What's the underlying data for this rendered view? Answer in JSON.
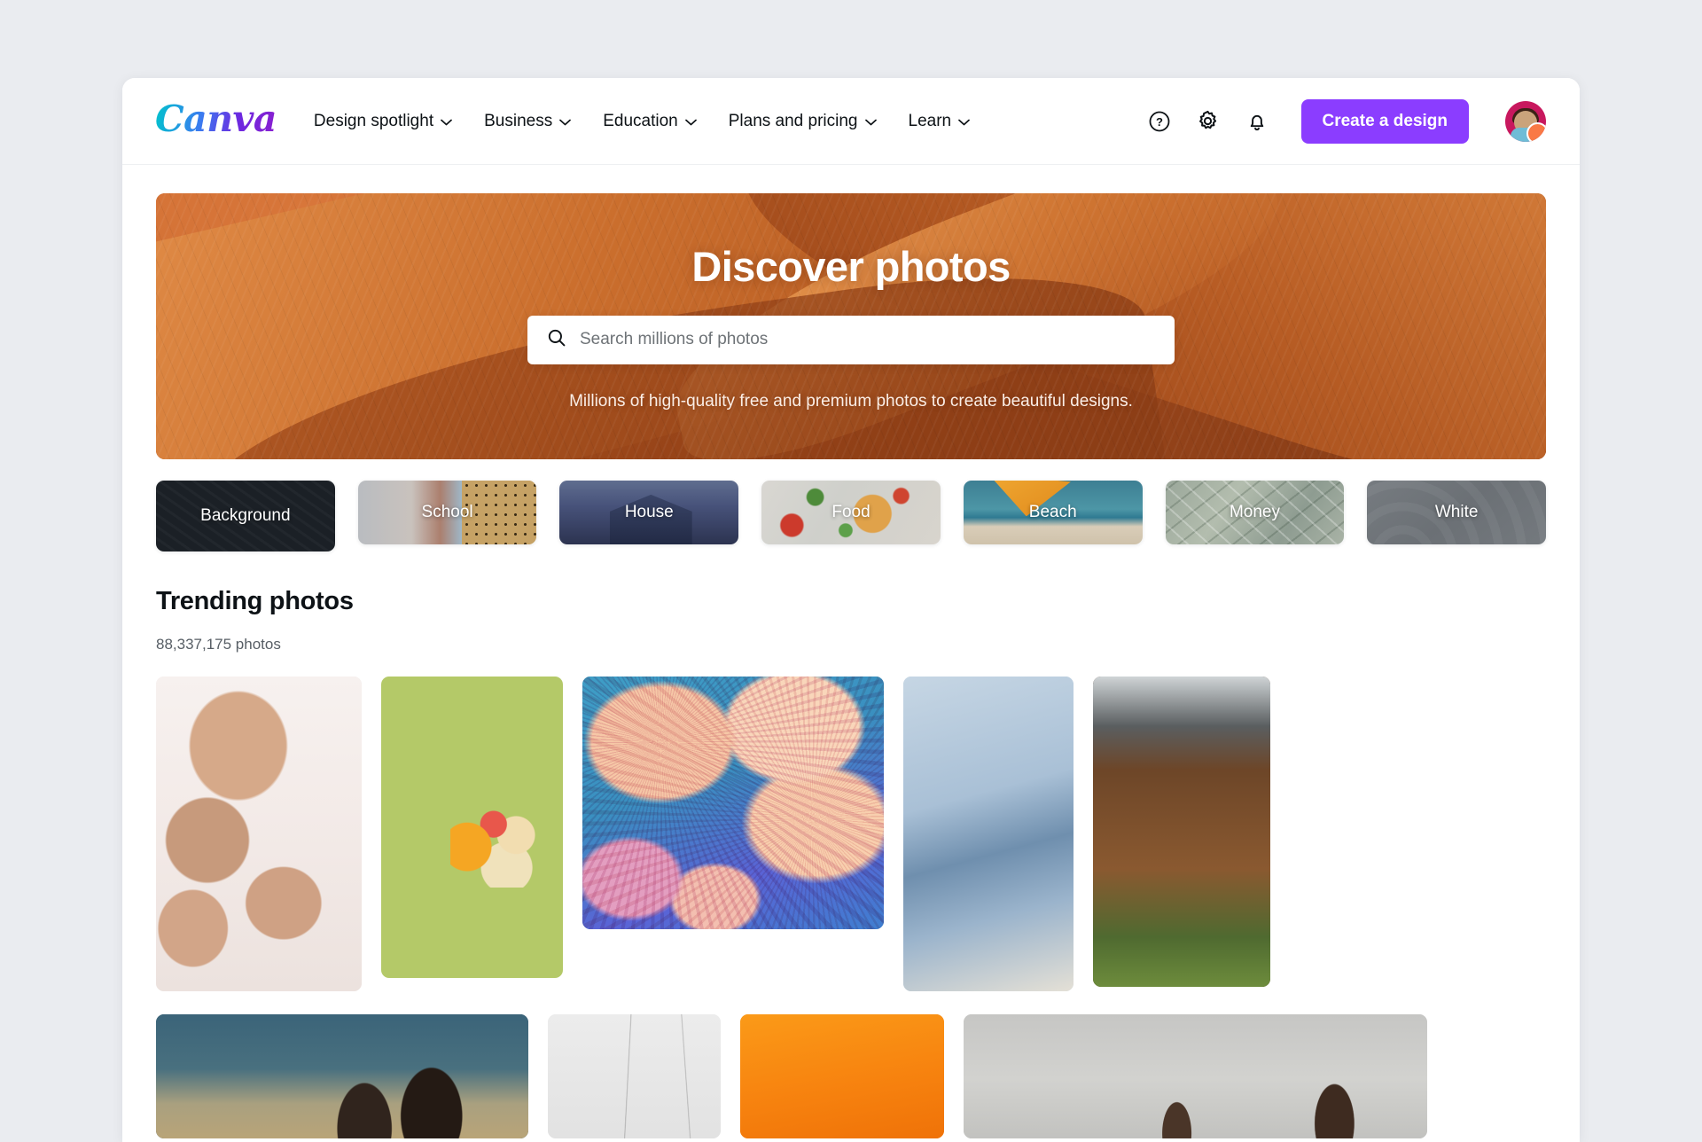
{
  "brand": {
    "logo_text": "Canva",
    "accent_color": "#8b3dff"
  },
  "header": {
    "nav": [
      {
        "label": "Design spotlight",
        "has_chevron": true
      },
      {
        "label": "Business",
        "has_chevron": true
      },
      {
        "label": "Education",
        "has_chevron": true
      },
      {
        "label": "Plans and pricing",
        "has_chevron": true
      },
      {
        "label": "Learn",
        "has_chevron": true
      }
    ],
    "icons": [
      {
        "name": "help-icon",
        "glyph": "?"
      },
      {
        "name": "gear-icon",
        "glyph": "gear"
      },
      {
        "name": "bell-icon",
        "glyph": "bell"
      }
    ],
    "cta_label": "Create a design",
    "avatar_name": "user-avatar"
  },
  "hero": {
    "title": "Discover photos",
    "search_placeholder": "Search millions of photos",
    "search_value": "",
    "subtitle": "Millions of high-quality free and premium photos to create beautiful designs.",
    "background": "desert-dunes"
  },
  "categories": [
    {
      "label": "Background",
      "art": "art-background"
    },
    {
      "label": "School",
      "art": "art-school"
    },
    {
      "label": "House",
      "art": "art-house"
    },
    {
      "label": "Food",
      "art": "art-food"
    },
    {
      "label": "Beach",
      "art": "art-beach"
    },
    {
      "label": "Money",
      "art": "art-money"
    },
    {
      "label": "White",
      "art": "art-white"
    }
  ],
  "section": {
    "title": "Trending photos",
    "count_text": "88,337,175 photos"
  },
  "grid": {
    "row1": [
      {
        "name": "photo-pregnancy-hands",
        "cls": "p-pregnancy"
      },
      {
        "name": "photo-sliced-fruit",
        "cls": "p-fruit"
      },
      {
        "name": "photo-neon-mushrooms",
        "cls": "p-mushroom"
      },
      {
        "name": "photo-denim-jackets",
        "cls": "p-denim"
      },
      {
        "name": "photo-timber-house-plants",
        "cls": "p-house2"
      }
    ],
    "row2": [
      {
        "name": "photo-beach-friends",
        "cls": "p-beachgirls"
      },
      {
        "name": "photo-minimal-lines",
        "cls": "p-minimal"
      },
      {
        "name": "photo-orange-gradient",
        "cls": "p-orange"
      },
      {
        "name": "photo-men-white-shirts",
        "cls": "p-men"
      }
    ]
  }
}
